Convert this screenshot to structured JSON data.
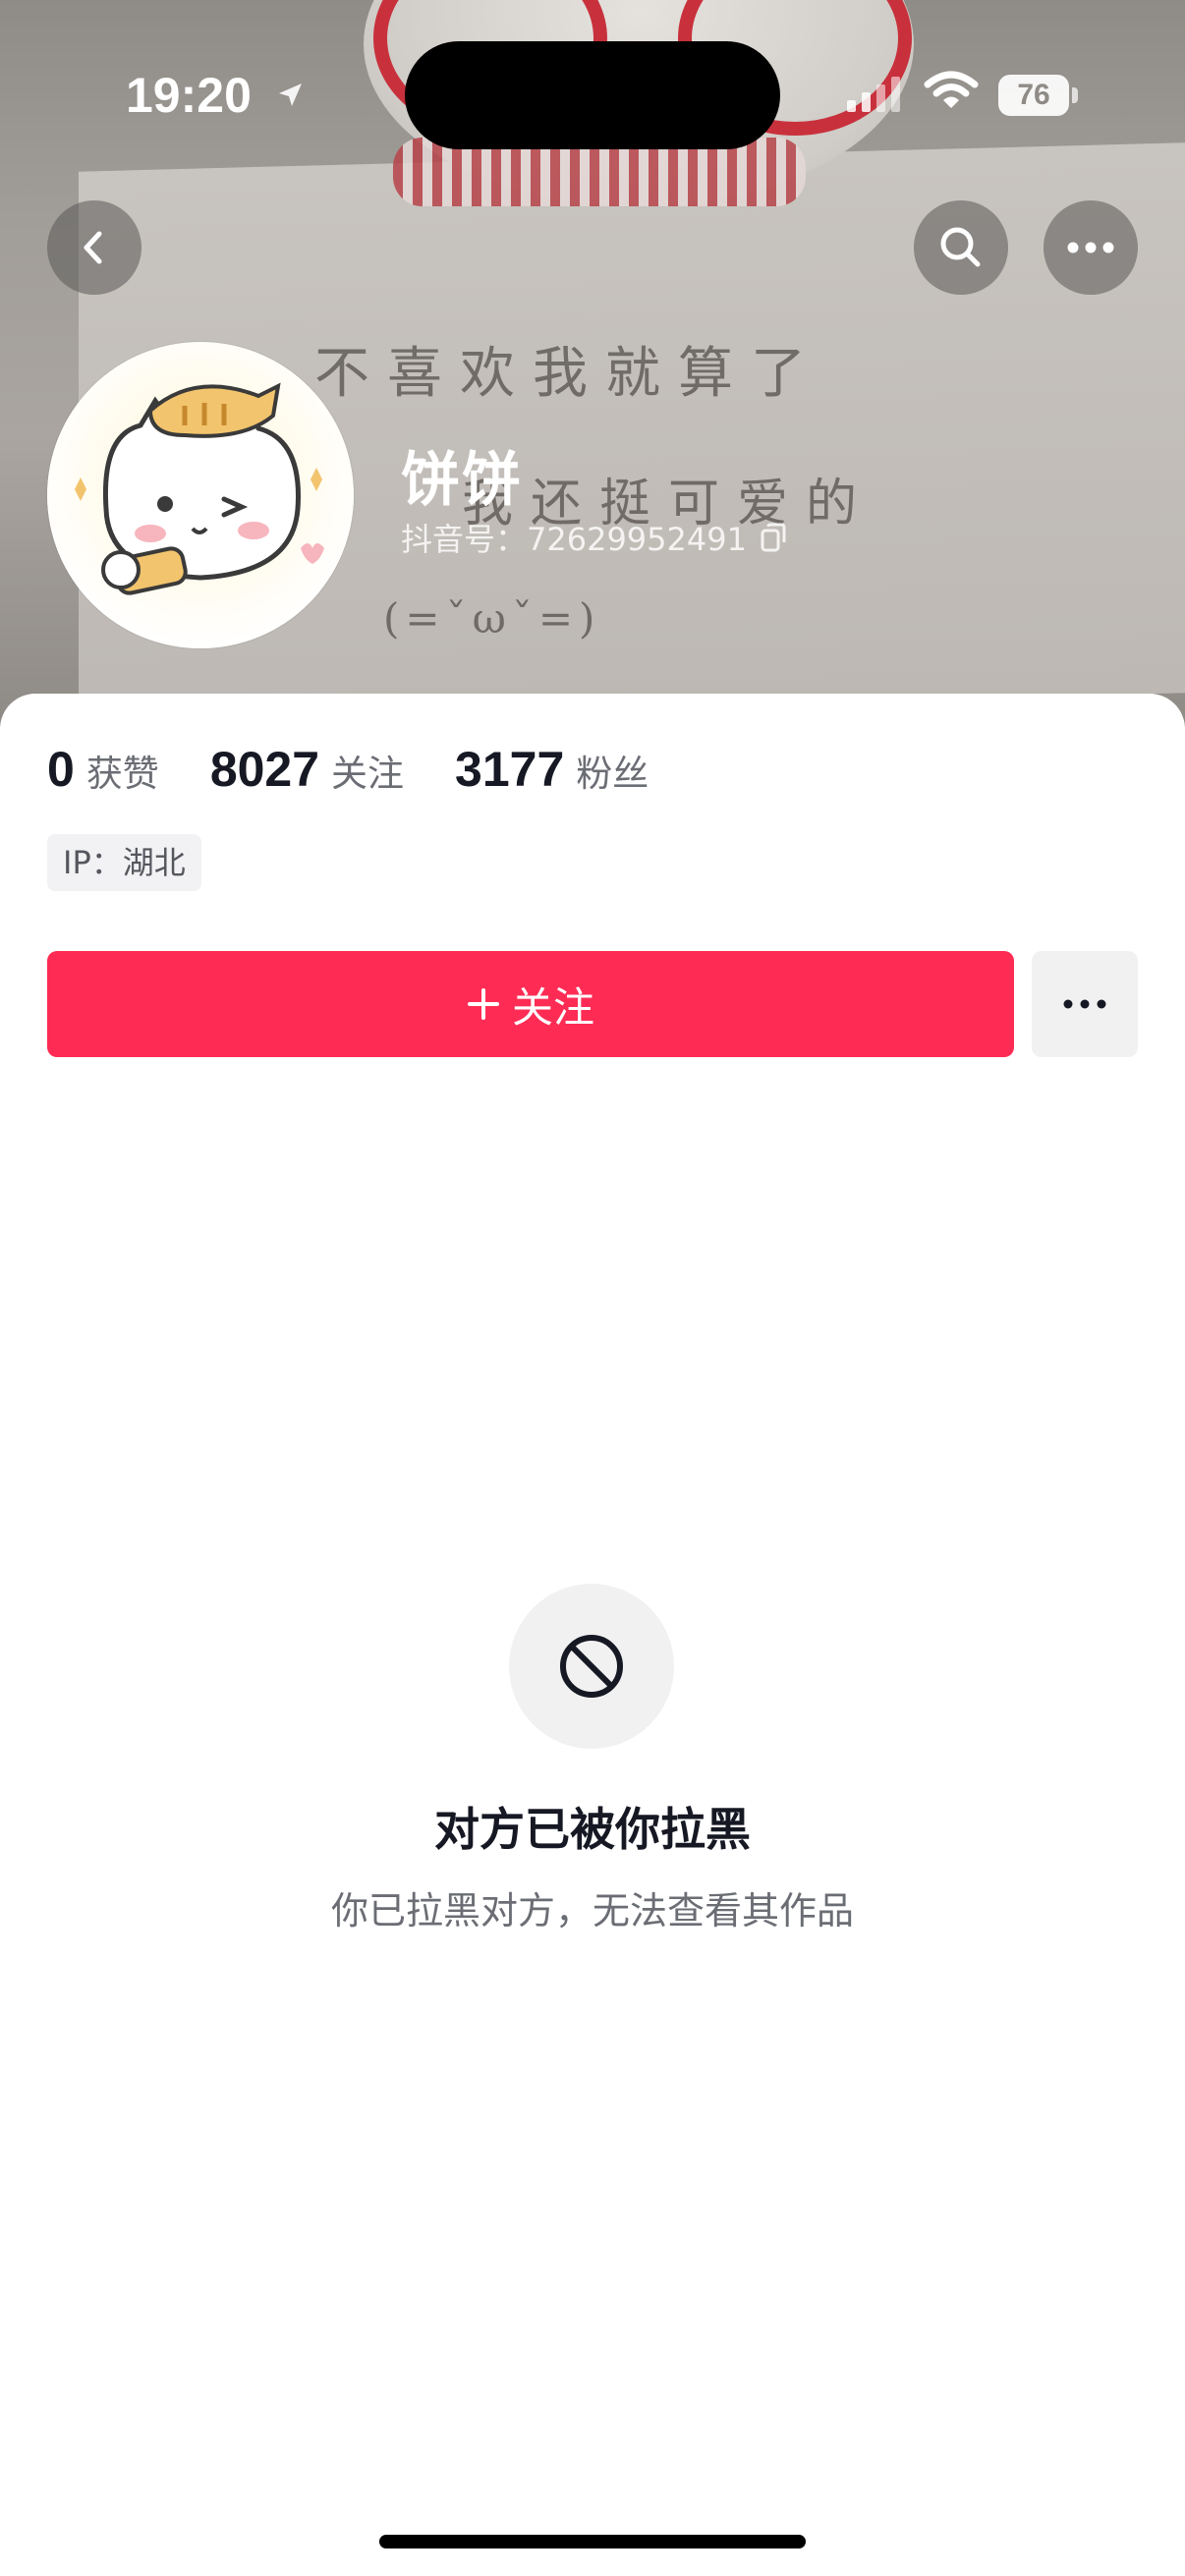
{
  "status_bar": {
    "time": "19:20",
    "battery_level": "76"
  },
  "cover": {
    "handwriting_line1": "不喜欢我就算了",
    "handwriting_line2": "我还挺可爱的",
    "handwriting_line3": "(=ˇωˇ=)"
  },
  "profile": {
    "name": "饼饼",
    "douyin_id": "抖音号：72629952491"
  },
  "stats": [
    {
      "value": "0",
      "label": "获赞"
    },
    {
      "value": "8027",
      "label": "关注"
    },
    {
      "value": "3177",
      "label": "粉丝"
    }
  ],
  "ip_location": "IP：湖北",
  "actions": {
    "follow_label": "关注"
  },
  "empty_state": {
    "title": "对方已被你拉黑",
    "subtitle": "你已拉黑对方，无法查看其作品"
  },
  "colors": {
    "accent": "#fe2c55",
    "text_primary": "#161823",
    "text_secondary": "#6b6d74"
  }
}
